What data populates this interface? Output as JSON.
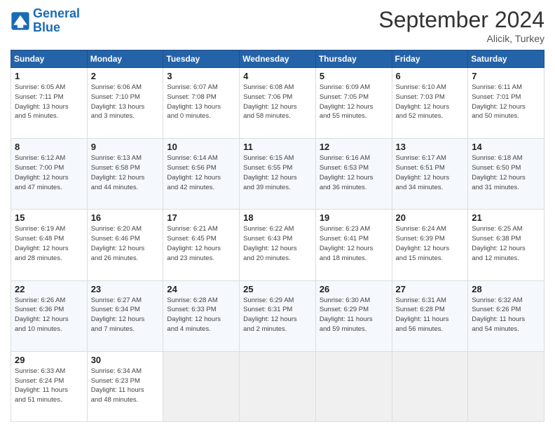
{
  "logo": {
    "line1": "General",
    "line2": "Blue"
  },
  "title": "September 2024",
  "location": "Alicik, Turkey",
  "weekdays": [
    "Sunday",
    "Monday",
    "Tuesday",
    "Wednesday",
    "Thursday",
    "Friday",
    "Saturday"
  ],
  "weeks": [
    [
      {
        "day": "1",
        "info": "Sunrise: 6:05 AM\nSunset: 7:11 PM\nDaylight: 13 hours\nand 5 minutes."
      },
      {
        "day": "2",
        "info": "Sunrise: 6:06 AM\nSunset: 7:10 PM\nDaylight: 13 hours\nand 3 minutes."
      },
      {
        "day": "3",
        "info": "Sunrise: 6:07 AM\nSunset: 7:08 PM\nDaylight: 13 hours\nand 0 minutes."
      },
      {
        "day": "4",
        "info": "Sunrise: 6:08 AM\nSunset: 7:06 PM\nDaylight: 12 hours\nand 58 minutes."
      },
      {
        "day": "5",
        "info": "Sunrise: 6:09 AM\nSunset: 7:05 PM\nDaylight: 12 hours\nand 55 minutes."
      },
      {
        "day": "6",
        "info": "Sunrise: 6:10 AM\nSunset: 7:03 PM\nDaylight: 12 hours\nand 52 minutes."
      },
      {
        "day": "7",
        "info": "Sunrise: 6:11 AM\nSunset: 7:01 PM\nDaylight: 12 hours\nand 50 minutes."
      }
    ],
    [
      {
        "day": "8",
        "info": "Sunrise: 6:12 AM\nSunset: 7:00 PM\nDaylight: 12 hours\nand 47 minutes."
      },
      {
        "day": "9",
        "info": "Sunrise: 6:13 AM\nSunset: 6:58 PM\nDaylight: 12 hours\nand 44 minutes."
      },
      {
        "day": "10",
        "info": "Sunrise: 6:14 AM\nSunset: 6:56 PM\nDaylight: 12 hours\nand 42 minutes."
      },
      {
        "day": "11",
        "info": "Sunrise: 6:15 AM\nSunset: 6:55 PM\nDaylight: 12 hours\nand 39 minutes."
      },
      {
        "day": "12",
        "info": "Sunrise: 6:16 AM\nSunset: 6:53 PM\nDaylight: 12 hours\nand 36 minutes."
      },
      {
        "day": "13",
        "info": "Sunrise: 6:17 AM\nSunset: 6:51 PM\nDaylight: 12 hours\nand 34 minutes."
      },
      {
        "day": "14",
        "info": "Sunrise: 6:18 AM\nSunset: 6:50 PM\nDaylight: 12 hours\nand 31 minutes."
      }
    ],
    [
      {
        "day": "15",
        "info": "Sunrise: 6:19 AM\nSunset: 6:48 PM\nDaylight: 12 hours\nand 28 minutes."
      },
      {
        "day": "16",
        "info": "Sunrise: 6:20 AM\nSunset: 6:46 PM\nDaylight: 12 hours\nand 26 minutes."
      },
      {
        "day": "17",
        "info": "Sunrise: 6:21 AM\nSunset: 6:45 PM\nDaylight: 12 hours\nand 23 minutes."
      },
      {
        "day": "18",
        "info": "Sunrise: 6:22 AM\nSunset: 6:43 PM\nDaylight: 12 hours\nand 20 minutes."
      },
      {
        "day": "19",
        "info": "Sunrise: 6:23 AM\nSunset: 6:41 PM\nDaylight: 12 hours\nand 18 minutes."
      },
      {
        "day": "20",
        "info": "Sunrise: 6:24 AM\nSunset: 6:39 PM\nDaylight: 12 hours\nand 15 minutes."
      },
      {
        "day": "21",
        "info": "Sunrise: 6:25 AM\nSunset: 6:38 PM\nDaylight: 12 hours\nand 12 minutes."
      }
    ],
    [
      {
        "day": "22",
        "info": "Sunrise: 6:26 AM\nSunset: 6:36 PM\nDaylight: 12 hours\nand 10 minutes."
      },
      {
        "day": "23",
        "info": "Sunrise: 6:27 AM\nSunset: 6:34 PM\nDaylight: 12 hours\nand 7 minutes."
      },
      {
        "day": "24",
        "info": "Sunrise: 6:28 AM\nSunset: 6:33 PM\nDaylight: 12 hours\nand 4 minutes."
      },
      {
        "day": "25",
        "info": "Sunrise: 6:29 AM\nSunset: 6:31 PM\nDaylight: 12 hours\nand 2 minutes."
      },
      {
        "day": "26",
        "info": "Sunrise: 6:30 AM\nSunset: 6:29 PM\nDaylight: 11 hours\nand 59 minutes."
      },
      {
        "day": "27",
        "info": "Sunrise: 6:31 AM\nSunset: 6:28 PM\nDaylight: 11 hours\nand 56 minutes."
      },
      {
        "day": "28",
        "info": "Sunrise: 6:32 AM\nSunset: 6:26 PM\nDaylight: 11 hours\nand 54 minutes."
      }
    ],
    [
      {
        "day": "29",
        "info": "Sunrise: 6:33 AM\nSunset: 6:24 PM\nDaylight: 11 hours\nand 51 minutes."
      },
      {
        "day": "30",
        "info": "Sunrise: 6:34 AM\nSunset: 6:23 PM\nDaylight: 11 hours\nand 48 minutes."
      },
      {
        "day": "",
        "info": ""
      },
      {
        "day": "",
        "info": ""
      },
      {
        "day": "",
        "info": ""
      },
      {
        "day": "",
        "info": ""
      },
      {
        "day": "",
        "info": ""
      }
    ]
  ]
}
